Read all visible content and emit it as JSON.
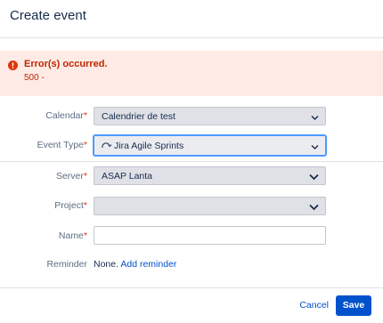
{
  "dialog": {
    "title": "Create event"
  },
  "error": {
    "title": "Error(s) occurred.",
    "message": "500 -"
  },
  "fields": {
    "calendar": {
      "label": "Calendar",
      "required_mark": "*",
      "value": "Calendrier de test"
    },
    "event_type": {
      "label": "Event Type",
      "required_mark": "*",
      "value": "Jira Agile Sprints",
      "icon": "sprint-icon"
    },
    "server": {
      "label": "Server",
      "required_mark": "*",
      "value": "ASAP Lanta"
    },
    "project": {
      "label": "Project",
      "required_mark": "*",
      "value": ""
    },
    "name": {
      "label": "Name",
      "required_mark": "*",
      "value": ""
    },
    "reminder": {
      "label": "Reminder",
      "value": "None.",
      "add_link": "Add reminder"
    }
  },
  "footer": {
    "cancel_label": "Cancel",
    "save_label": "Save"
  },
  "colors": {
    "accent": "#0052cc",
    "error": "#de350b",
    "error_bg": "#ffebe6"
  }
}
